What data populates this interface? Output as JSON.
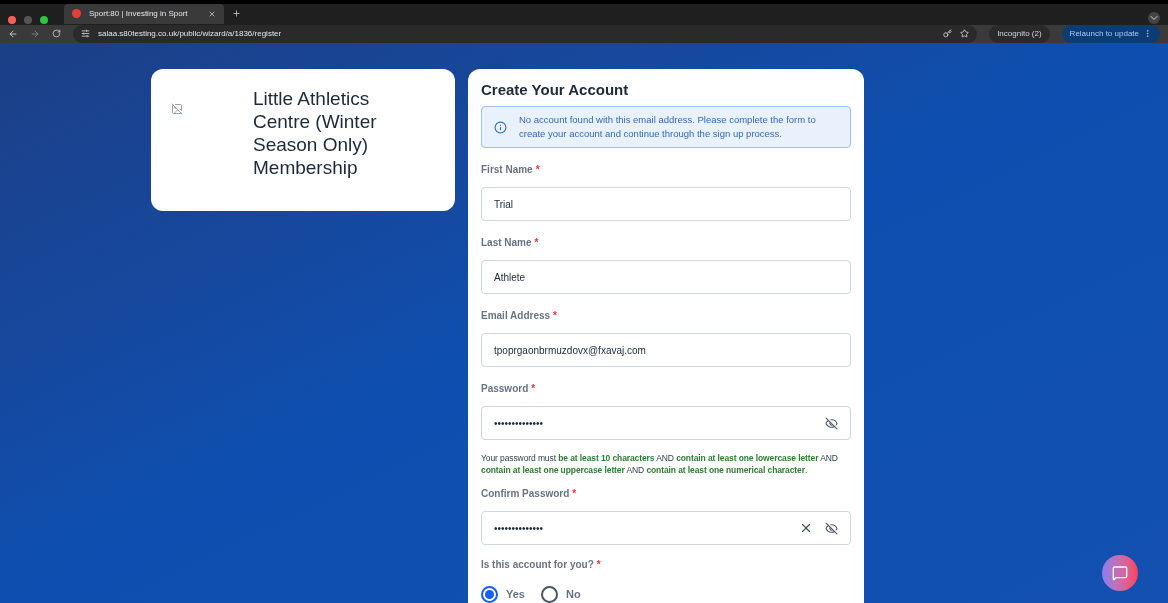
{
  "browser": {
    "tab_title": "Sport:80 | Investing in Sport",
    "url": "salaa.s80testing.co.uk/public/wizard/a/1836/register",
    "incognito": "Incognito (2)",
    "relaunch": "Relaunch to update"
  },
  "product_card": {
    "title": "Little Athletics Centre (Winter Season Only) Membership"
  },
  "form": {
    "title": "Create Your Account",
    "required_mark": "*",
    "notice": "No account found with this email address. Please complete the form to create your account and continue through the sign up process.",
    "fields": [
      {
        "kind": "text",
        "label": "First Name",
        "required": true,
        "value": "Trial"
      },
      {
        "kind": "text",
        "label": "Last Name",
        "required": true,
        "value": "Athlete"
      },
      {
        "kind": "text",
        "label": "Email Address",
        "required": true,
        "value": "tpoprgaonbrmuzdovx@fxavaj.com"
      },
      {
        "kind": "password",
        "label": "Password",
        "required": true,
        "value": "••••••••••••••",
        "clearable": false
      },
      {
        "kind": "hint",
        "segments": [
          {
            "text": "Your password must ",
            "met": false
          },
          {
            "text": "be at least 10 characters",
            "met": true
          },
          {
            "text": " AND ",
            "met": false
          },
          {
            "text": "contain at least one lowercase letter",
            "met": true
          },
          {
            "text": " AND ",
            "met": false
          },
          {
            "text": "contain at least one uppercase letter",
            "met": true
          },
          {
            "text": " AND ",
            "met": false
          },
          {
            "text": "contain at least one numerical character",
            "met": true
          },
          {
            "text": ".",
            "met": false
          }
        ]
      },
      {
        "kind": "password",
        "label": "Confirm Password",
        "required": true,
        "value": "••••••••••••••",
        "clearable": true
      },
      {
        "kind": "radio",
        "label": "Is this account for you?",
        "required": true,
        "options": [
          {
            "label": "Yes",
            "selected": true
          },
          {
            "label": "No",
            "selected": false
          }
        ]
      }
    ]
  }
}
